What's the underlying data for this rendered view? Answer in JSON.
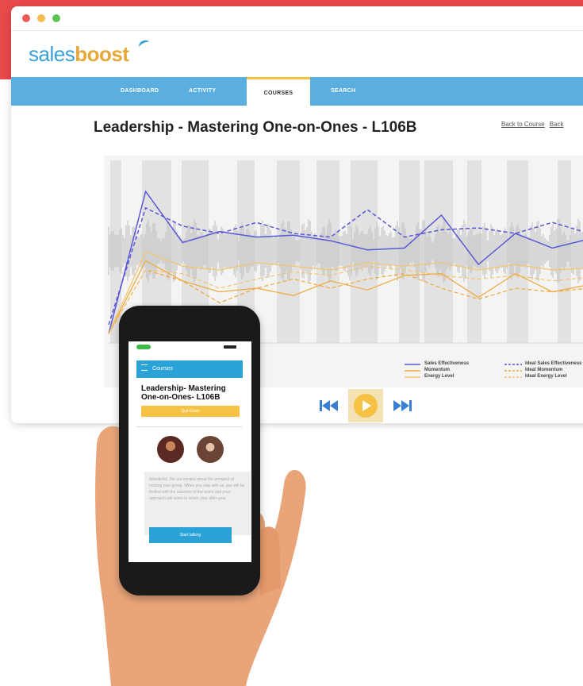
{
  "brand": {
    "name_light": "sales",
    "name_bold": "boost"
  },
  "nav": {
    "items": [
      {
        "label": "DASHBOARD",
        "active": false
      },
      {
        "label": "ACTIVITY",
        "active": false
      },
      {
        "label": "COURSES",
        "active": true
      },
      {
        "label": "SEARCH",
        "active": false
      }
    ]
  },
  "page": {
    "title": "Leadership - Mastering One-on-Ones - L106B",
    "back_to_course": "Back to Course",
    "back_truncated": "Back"
  },
  "chart": {
    "legend": [
      {
        "label": "Sales Effectiveness",
        "color": "#5a58d6",
        "style": "solid"
      },
      {
        "label": "Momentum",
        "color": "#f0a83a",
        "style": "solid"
      },
      {
        "label": "Energy Level",
        "color": "#f5c46a",
        "style": "solid"
      },
      {
        "label": "Ideal Sales Effectiveness",
        "color": "#5a58d6",
        "style": "dashed"
      },
      {
        "label": "Ideal Momentum",
        "color": "#f0a83a",
        "style": "dashed"
      },
      {
        "label": "Ideal Energy Level",
        "color": "#f5c46a",
        "style": "dashed"
      }
    ]
  },
  "chart_data": {
    "type": "line",
    "x": [
      0,
      1,
      2,
      3,
      4,
      5,
      6,
      7,
      8,
      9,
      10,
      11,
      12,
      13
    ],
    "series": [
      {
        "name": "Sales Effectiveness",
        "values": [
          0.05,
          0.83,
          0.55,
          0.61,
          0.58,
          0.59,
          0.56,
          0.51,
          0.52,
          0.7,
          0.43,
          0.6,
          0.52,
          0.57
        ]
      },
      {
        "name": "Ideal Sales Effectiveness",
        "values": [
          0.1,
          0.74,
          0.64,
          0.6,
          0.66,
          0.6,
          0.58,
          0.73,
          0.58,
          0.62,
          0.63,
          0.6,
          0.66,
          0.6
        ]
      },
      {
        "name": "Momentum",
        "values": [
          0.05,
          0.45,
          0.34,
          0.28,
          0.3,
          0.26,
          0.34,
          0.29,
          0.37,
          0.38,
          0.25,
          0.38,
          0.28,
          0.32
        ]
      },
      {
        "name": "Ideal Momentum",
        "values": [
          0.05,
          0.4,
          0.34,
          0.22,
          0.3,
          0.35,
          0.3,
          0.35,
          0.38,
          0.3,
          0.24,
          0.3,
          0.28,
          0.3
        ]
      },
      {
        "name": "Energy Level",
        "values": [
          0.05,
          0.5,
          0.42,
          0.4,
          0.44,
          0.42,
          0.4,
          0.44,
          0.42,
          0.44,
          0.4,
          0.43,
          0.4,
          0.41
        ]
      },
      {
        "name": "Ideal Energy Level",
        "values": [
          0.05,
          0.4,
          0.38,
          0.3,
          0.35,
          0.39,
          0.37,
          0.42,
          0.4,
          0.37,
          0.35,
          0.37,
          0.34,
          0.36
        ]
      }
    ],
    "ylim": [
      0,
      1
    ]
  },
  "player": {
    "prev_icon": "skip-back-icon",
    "play_icon": "play-icon",
    "next_icon": "skip-forward-icon"
  },
  "phone": {
    "header_label": "Courses",
    "title": "Leadership- Mastering One-on-Ones- L106B",
    "quit_label": "Quit Exam",
    "message": "Wonderful. We are excited about the prospect of hosting your group. When you stay with us, you will be thrilled with the outcome of the event and your approach will seem to return your after-year.",
    "cta_label": "Start talking"
  },
  "colors": {
    "accent_blue": "#5aafe0",
    "accent_yellow": "#f5c243",
    "brand_red": "#e8494b",
    "skin": "#e9a579"
  }
}
